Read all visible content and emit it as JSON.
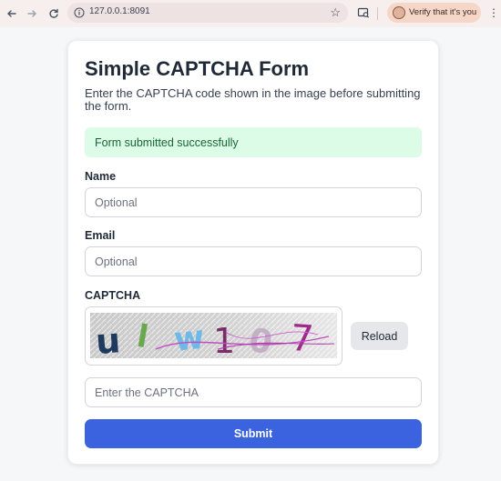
{
  "browser": {
    "url": "127.0.0.1:8091",
    "verify_label": "Verify that it's you",
    "back_icon": "arrow-left-icon",
    "forward_icon": "arrow-right-icon",
    "reload_icon": "reload-icon",
    "info_icon": "info-icon",
    "bookmark_icon": "star-icon"
  },
  "form": {
    "title": "Simple CAPTCHA Form",
    "description": "Enter the CAPTCHA code shown in the image before submitting the form.",
    "success_message": "Form submitted successfully",
    "name_label": "Name",
    "name_placeholder": "Optional",
    "name_value": "",
    "email_label": "Email",
    "email_placeholder": "Optional",
    "email_value": "",
    "captcha_label": "CAPTCHA",
    "captcha_text": "ulw107",
    "reload_label": "Reload",
    "captcha_placeholder": "Enter the CAPTCHA",
    "captcha_value": "",
    "submit_label": "Submit"
  },
  "colors": {
    "primary": "#3b63e0",
    "success_bg": "#dcfce7",
    "success_text": "#166534"
  }
}
